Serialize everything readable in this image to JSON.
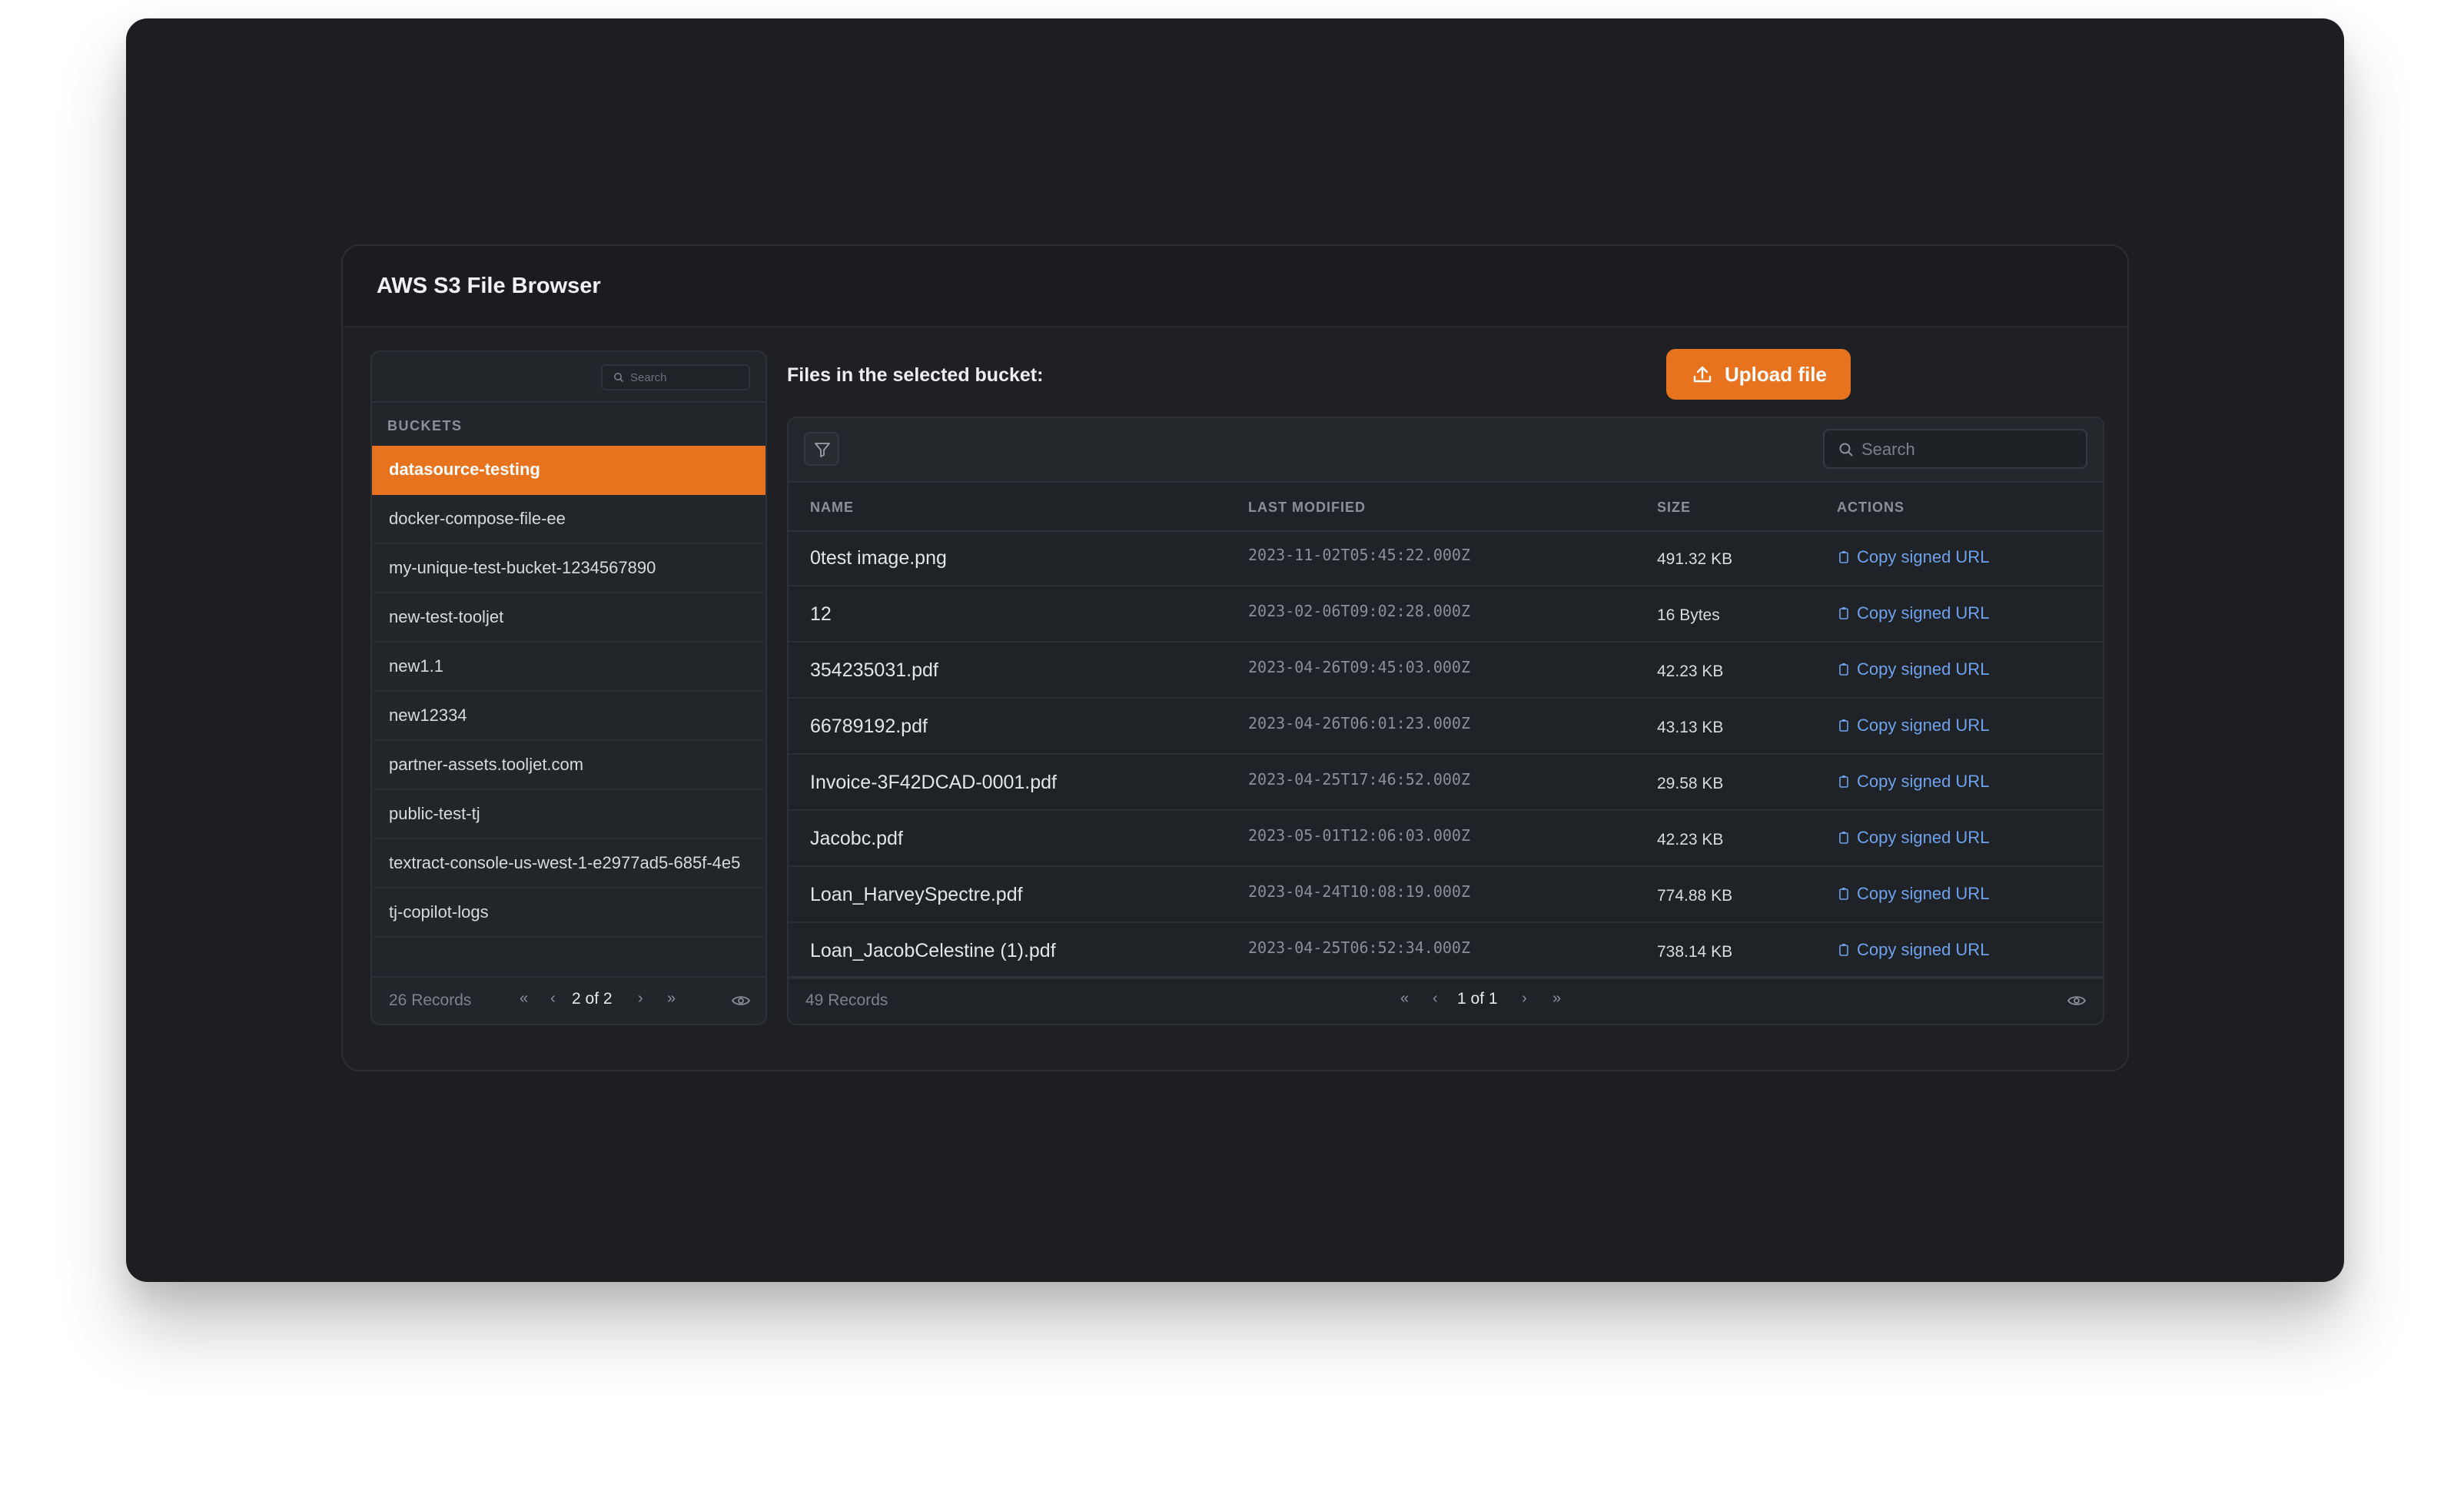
{
  "app": {
    "title": "AWS S3 File Browser"
  },
  "buckets": {
    "search_placeholder": "Search",
    "header": "BUCKETS",
    "items": [
      "datasource-testing",
      "docker-compose-file-ee",
      "my-unique-test-bucket-1234567890",
      "new-test-tooljet",
      "new1.1",
      "new12334",
      "partner-assets.tooljet.com",
      "public-test-tj",
      "textract-console-us-west-1-e2977ad5-685f-4e5",
      "tj-copilot-logs"
    ],
    "selected": "datasource-testing",
    "records": "26 Records",
    "page": "2 of 2"
  },
  "files": {
    "label": "Files in the selected bucket:",
    "upload_label": "Upload file",
    "search_placeholder": "Search",
    "columns": {
      "name": "NAME",
      "modified": "LAST MODIFIED",
      "size": "SIZE",
      "actions": "ACTIONS"
    },
    "rows": [
      {
        "name": "0test image.png",
        "modified": "2023-11-02T05:45:22.000Z",
        "size": "491.32 KB",
        "action": "Copy signed URL"
      },
      {
        "name": "12",
        "modified": "2023-02-06T09:02:28.000Z",
        "size": "16 Bytes",
        "action": "Copy signed URL"
      },
      {
        "name": "354235031.pdf",
        "modified": "2023-04-26T09:45:03.000Z",
        "size": "42.23 KB",
        "action": "Copy signed URL"
      },
      {
        "name": "66789192.pdf",
        "modified": "2023-04-26T06:01:23.000Z",
        "size": "43.13 KB",
        "action": "Copy signed URL"
      },
      {
        "name": "Invoice-3F42DCAD-0001.pdf",
        "modified": "2023-04-25T17:46:52.000Z",
        "size": "29.58 KB",
        "action": "Copy signed URL"
      },
      {
        "name": "Jacobc.pdf",
        "modified": "2023-05-01T12:06:03.000Z",
        "size": "42.23 KB",
        "action": "Copy signed URL"
      },
      {
        "name": "Loan_HarveySpectre.pdf",
        "modified": "2023-04-24T10:08:19.000Z",
        "size": "774.88 KB",
        "action": "Copy signed URL"
      },
      {
        "name": "Loan_JacobCelestine (1).pdf",
        "modified": "2023-04-25T06:52:34.000Z",
        "size": "738.14 KB",
        "action": "Copy signed URL"
      }
    ],
    "records": "49 Records",
    "page": "1 of 1"
  },
  "colors": {
    "accent": "#e8731f",
    "link": "#6ea2ec",
    "background": "#1c1e22"
  },
  "icons": [
    "search-icon",
    "filter-icon",
    "upload-icon",
    "copy-icon",
    "eye-icon",
    "first-page-icon",
    "prev-page-icon",
    "next-page-icon",
    "last-page-icon"
  ]
}
